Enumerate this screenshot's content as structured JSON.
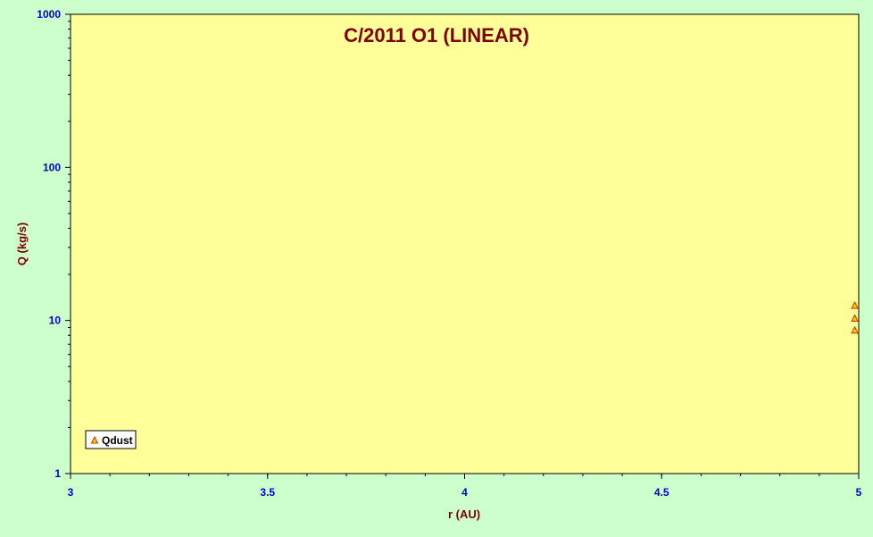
{
  "chart_data": {
    "type": "scatter",
    "title": "C/2011 O1 (LINEAR)",
    "xlabel": "r (AU)",
    "ylabel": "Q (kg/s)",
    "xlim": [
      3,
      5
    ],
    "ylim": [
      1,
      1000
    ],
    "y_scale": "log",
    "x_ticks": [
      "3",
      "3.5",
      "4",
      "4.5",
      "5"
    ],
    "y_ticks": [
      "1",
      "10",
      "100",
      "1000"
    ],
    "x_tick_values": [
      3,
      3.5,
      4,
      4.5,
      5
    ],
    "y_tick_values": [
      1,
      10,
      100,
      1000
    ],
    "x_minor_step": 0.1,
    "grid": false,
    "legend_position": "bottom-left",
    "colors": {
      "page_background": "#ccffcc",
      "plot_background": "#ffff99",
      "marker_stroke": "#cc3300",
      "marker_fill": "#ffcc00",
      "title": "#800000",
      "tick_labels": "#0000cc"
    },
    "series": [
      {
        "name": "Qdust",
        "marker": "triangle",
        "points": [
          {
            "x": 4.99,
            "y": 12.5
          },
          {
            "x": 4.99,
            "y": 10.3
          },
          {
            "x": 4.99,
            "y": 8.6
          }
        ]
      }
    ]
  }
}
